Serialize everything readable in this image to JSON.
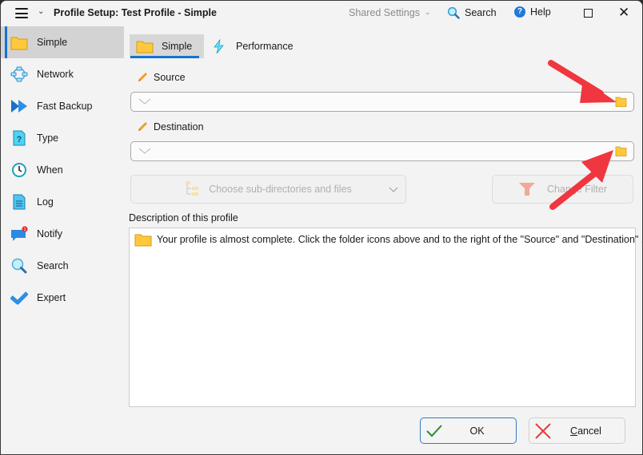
{
  "window": {
    "title": "Profile Setup: Test Profile - Simple",
    "shared_settings": "Shared Settings",
    "search_label": "Search",
    "help_label": "Help"
  },
  "sidebar": {
    "items": [
      {
        "label": "Simple",
        "icon": "folder-icon",
        "active": true
      },
      {
        "label": "Network",
        "icon": "network-icon"
      },
      {
        "label": "Fast Backup",
        "icon": "fast-forward-icon"
      },
      {
        "label": "Type",
        "icon": "question-doc-icon"
      },
      {
        "label": "When",
        "icon": "clock-icon"
      },
      {
        "label": "Log",
        "icon": "document-icon"
      },
      {
        "label": "Notify",
        "icon": "chat-bubble-icon",
        "badge": "1"
      },
      {
        "label": "Search",
        "icon": "magnifier-icon"
      },
      {
        "label": "Expert",
        "icon": "checkmark-icon"
      }
    ]
  },
  "tabs": [
    {
      "label": "Simple",
      "icon": "folder-icon",
      "active": true
    },
    {
      "label": "Performance",
      "icon": "lightning-icon"
    }
  ],
  "source": {
    "label": "Source",
    "value": ""
  },
  "destination": {
    "label": "Destination",
    "value": ""
  },
  "subdirs_button": {
    "label": "Choose sub-directories and files",
    "mnemonic_index": 26
  },
  "filter_button": {
    "label": "Change Filter"
  },
  "description": {
    "label": "Description of this profile",
    "text": "Your profile is almost complete. Click the folder icons above and to the right of the \"Source\" and \"Destination\" ..."
  },
  "footer": {
    "ok_label": "OK",
    "cancel_label": "Cancel"
  },
  "colors": {
    "accent": "#1473d1",
    "annotation_arrow": "#f0363f",
    "folder": "#ffc83d"
  }
}
